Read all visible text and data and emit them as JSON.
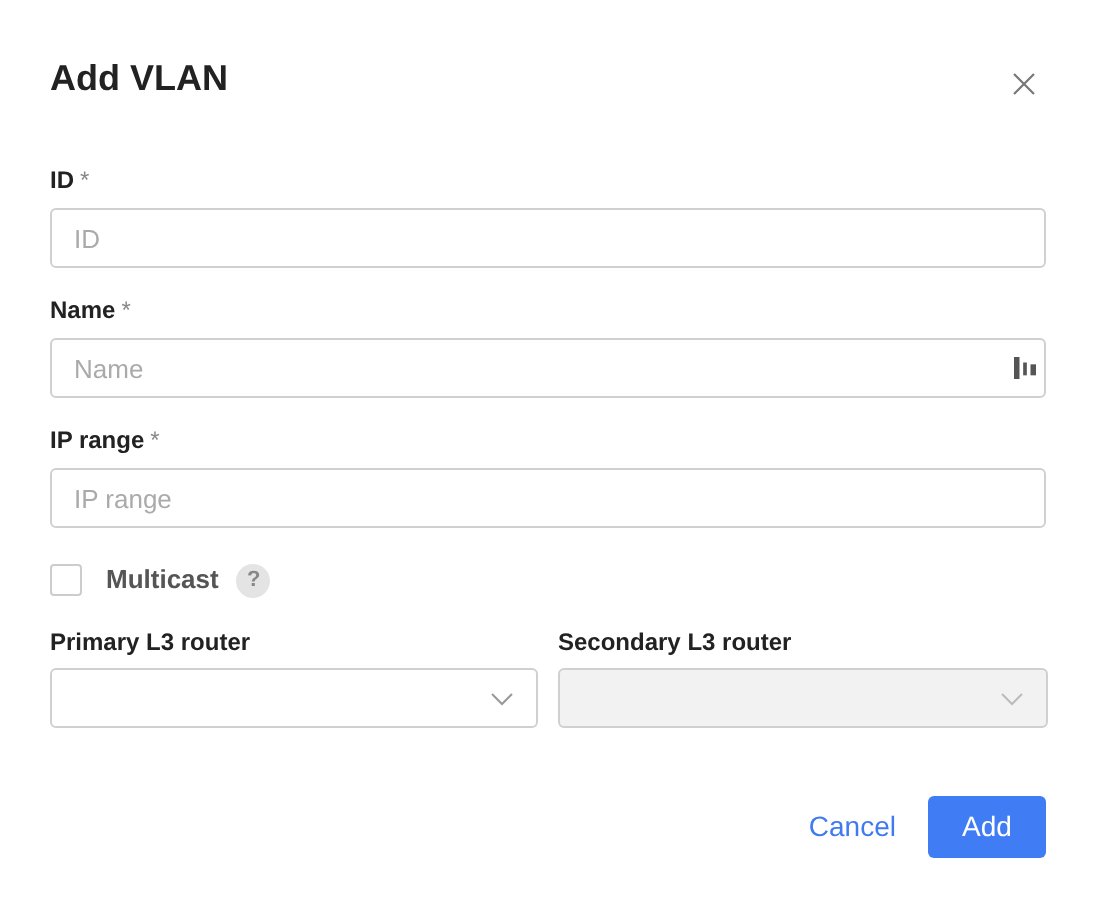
{
  "dialog": {
    "title": "Add VLAN"
  },
  "fields": [
    {
      "label": "ID",
      "required_mark": "*",
      "placeholder": "ID",
      "has_autofill_icon": false
    },
    {
      "label": "Name",
      "required_mark": "*",
      "placeholder": "Name",
      "has_autofill_icon": true
    },
    {
      "label": "IP range",
      "required_mark": "*",
      "placeholder": "IP range",
      "has_autofill_icon": false
    }
  ],
  "multicast": {
    "label": "Multicast",
    "checked": false,
    "help": "?"
  },
  "selects": [
    {
      "label": "Primary L3 router",
      "disabled": false
    },
    {
      "label": "Secondary L3 router",
      "disabled": true
    }
  ],
  "buttons": {
    "cancel": "Cancel",
    "add": "Add"
  }
}
